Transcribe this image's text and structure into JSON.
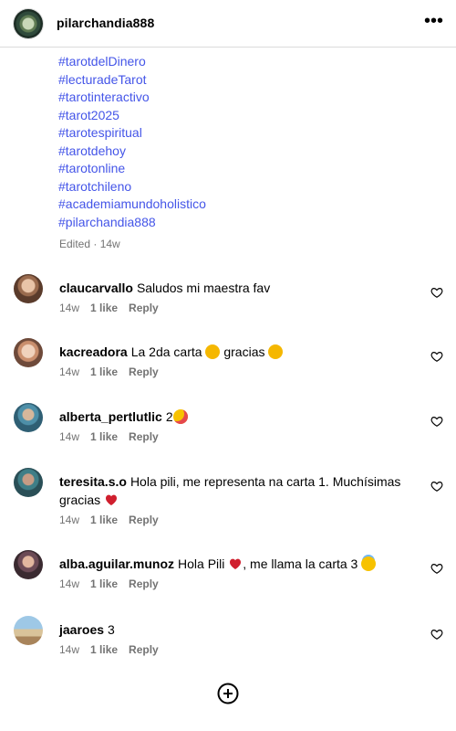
{
  "header": {
    "username": "pilarchandia888",
    "more_icon": "more-horizontal-icon"
  },
  "caption": {
    "hashtags": [
      "#tarotdelDinero",
      "#lecturadeTarot",
      "#tarotinteractivo",
      "#tarot2025",
      "#tarotespiritual",
      "#tarotdehoy",
      "#tarotonline",
      "#tarotchileno",
      "#academiamundoholistico",
      "#pilarchandia888"
    ],
    "edited": "Edited · 14w"
  },
  "comments": [
    {
      "username": "claucarvallo",
      "text": "Saludos mi maestra fav",
      "time": "14w",
      "likes": "1 like",
      "reply": "Reply"
    },
    {
      "username": "kacreadora",
      "text": "La 2da carta",
      "text2": "gracias",
      "time": "14w",
      "likes": "1 like",
      "reply": "Reply"
    },
    {
      "username": "alberta_pertlutlic",
      "text": "2",
      "time": "14w",
      "likes": "1 like",
      "reply": "Reply"
    },
    {
      "username": "teresita.s.o",
      "text": "Hola pili, me representa na carta 1. Muchísimas gracias",
      "time": "14w",
      "likes": "1 like",
      "reply": "Reply"
    },
    {
      "username": "alba.aguilar.munoz",
      "text": "Hola Pili",
      "text2": ", me llama la carta 3",
      "time": "14w",
      "likes": "1 like",
      "reply": "Reply"
    },
    {
      "username": "jaaroes",
      "text": "3",
      "time": "14w",
      "likes": "1 like",
      "reply": "Reply"
    }
  ],
  "icons": {
    "heart": "heart-outline-icon",
    "add": "plus-circle-icon"
  }
}
